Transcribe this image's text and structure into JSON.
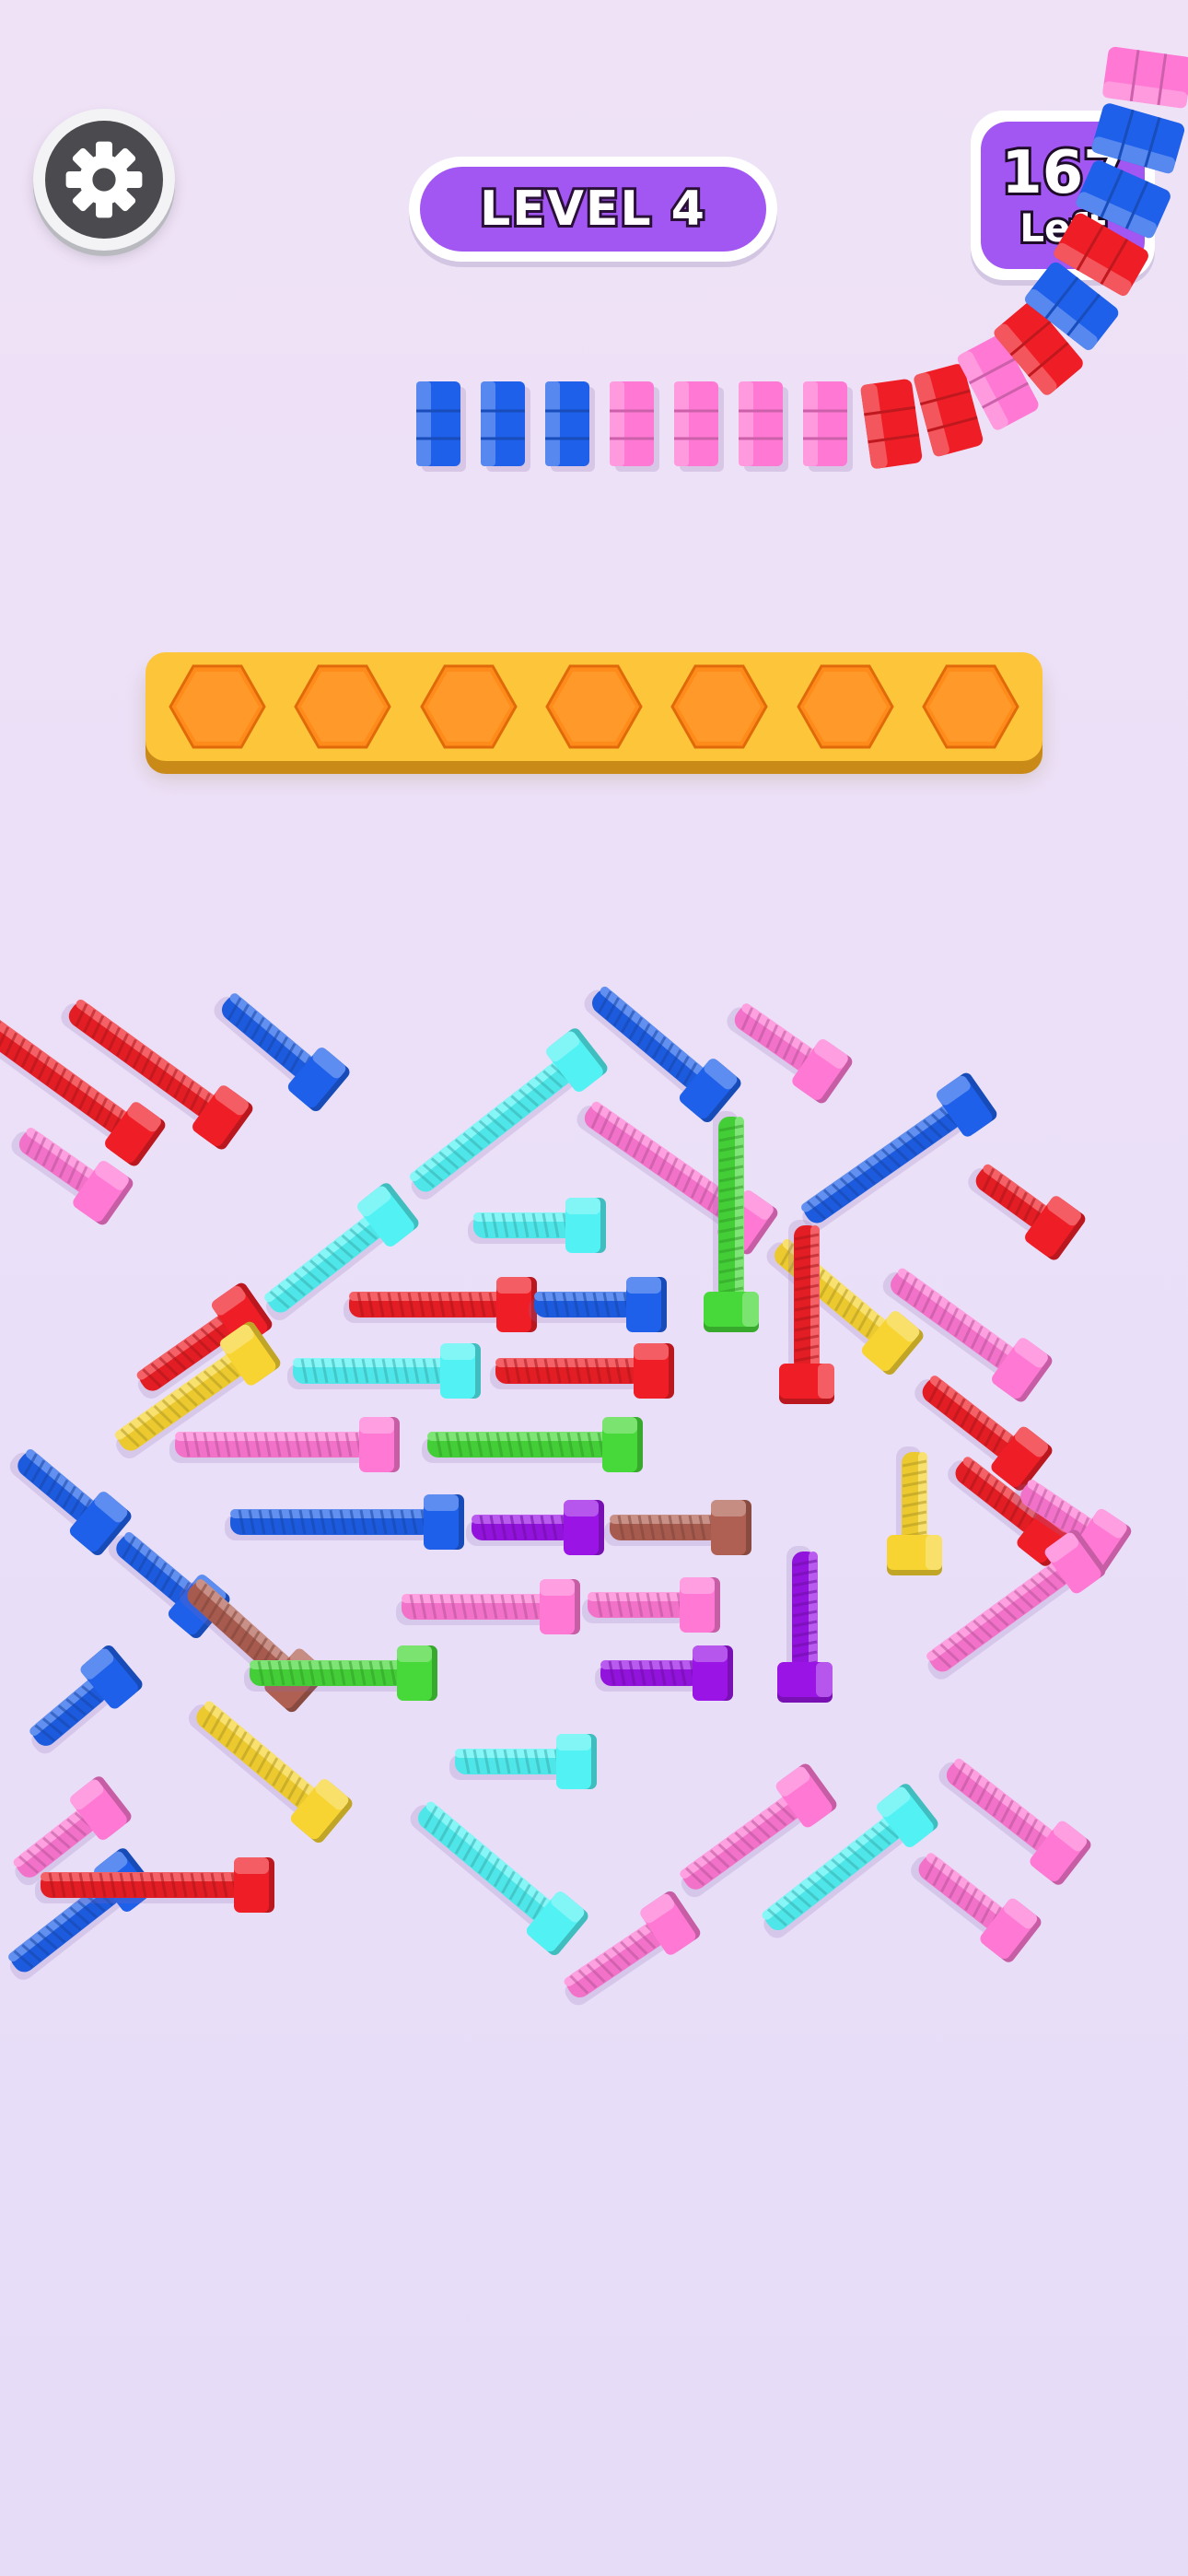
{
  "header": {
    "level_label": "LEVEL 4",
    "remaining_count": "167",
    "remaining_label": "Left",
    "settings_icon": "gear-icon"
  },
  "tray": {
    "slot_count": 7,
    "slot_icon": "hexagon-slot-icon",
    "color": "#fcc53a",
    "slot_color": "#ff8c1a"
  },
  "nut_queue": {
    "colors_in_row": [
      "blue",
      "blue",
      "blue",
      "pink",
      "pink",
      "pink",
      "pink"
    ],
    "colors_on_curve": [
      "red",
      "red",
      "pink",
      "red",
      "blue",
      "red",
      "blue",
      "blue",
      "pink"
    ]
  },
  "palette": {
    "red": "#ef1e26",
    "pink": "#ff78d4",
    "blue": "#1e60ea",
    "cyan": "#52f2f4",
    "green": "#47d93a",
    "yellow": "#f7d431",
    "purple": "#9a14e6",
    "brown": "#b06052"
  },
  "bolts": [
    {
      "color": "red",
      "angle": 36
    },
    {
      "color": "red",
      "angle": 36
    },
    {
      "color": "blue",
      "angle": 40
    },
    {
      "color": "pink",
      "angle": 35
    },
    {
      "color": "cyan",
      "angle": -38
    },
    {
      "color": "pink",
      "angle": 35
    },
    {
      "color": "blue",
      "angle": 40
    },
    {
      "color": "pink",
      "angle": 35
    },
    {
      "color": "blue",
      "angle": -35
    },
    {
      "color": "red",
      "angle": 36
    },
    {
      "color": "cyan",
      "angle": -38
    },
    {
      "color": "cyan",
      "angle": 0
    },
    {
      "color": "red",
      "angle": -35
    },
    {
      "color": "yellow",
      "angle": -35
    },
    {
      "color": "red",
      "angle": 0
    },
    {
      "color": "blue",
      "angle": 0
    },
    {
      "color": "green",
      "angle": 90
    },
    {
      "color": "yellow",
      "angle": 40
    },
    {
      "color": "red",
      "angle": 90
    },
    {
      "color": "pink",
      "angle": 36
    },
    {
      "color": "red",
      "angle": 38
    },
    {
      "color": "cyan",
      "angle": 0
    },
    {
      "color": "red",
      "angle": 0
    },
    {
      "color": "pink",
      "angle": 0
    },
    {
      "color": "green",
      "angle": 0
    },
    {
      "color": "red",
      "angle": 38
    },
    {
      "color": "blue",
      "angle": 40
    },
    {
      "color": "blue",
      "angle": 0
    },
    {
      "color": "purple",
      "angle": 0
    },
    {
      "color": "brown",
      "angle": 0
    },
    {
      "color": "yellow",
      "angle": 90
    },
    {
      "color": "pink",
      "angle": 34
    },
    {
      "color": "blue",
      "angle": 40
    },
    {
      "color": "pink",
      "angle": 0
    },
    {
      "color": "pink",
      "angle": 0
    },
    {
      "color": "purple",
      "angle": 90
    },
    {
      "color": "pink",
      "angle": -36
    },
    {
      "color": "blue",
      "angle": -40
    },
    {
      "color": "brown",
      "angle": 42
    },
    {
      "color": "green",
      "angle": 0
    },
    {
      "color": "purple",
      "angle": 0
    },
    {
      "color": "yellow",
      "angle": 40
    },
    {
      "color": "pink",
      "angle": -38
    },
    {
      "color": "cyan",
      "angle": 0
    },
    {
      "color": "pink",
      "angle": -36
    },
    {
      "color": "pink",
      "angle": 38
    },
    {
      "color": "blue",
      "angle": -38
    },
    {
      "color": "red",
      "angle": 0
    },
    {
      "color": "cyan",
      "angle": 40
    },
    {
      "color": "pink",
      "angle": -34
    },
    {
      "color": "cyan",
      "angle": -38
    },
    {
      "color": "pink",
      "angle": 38
    }
  ]
}
